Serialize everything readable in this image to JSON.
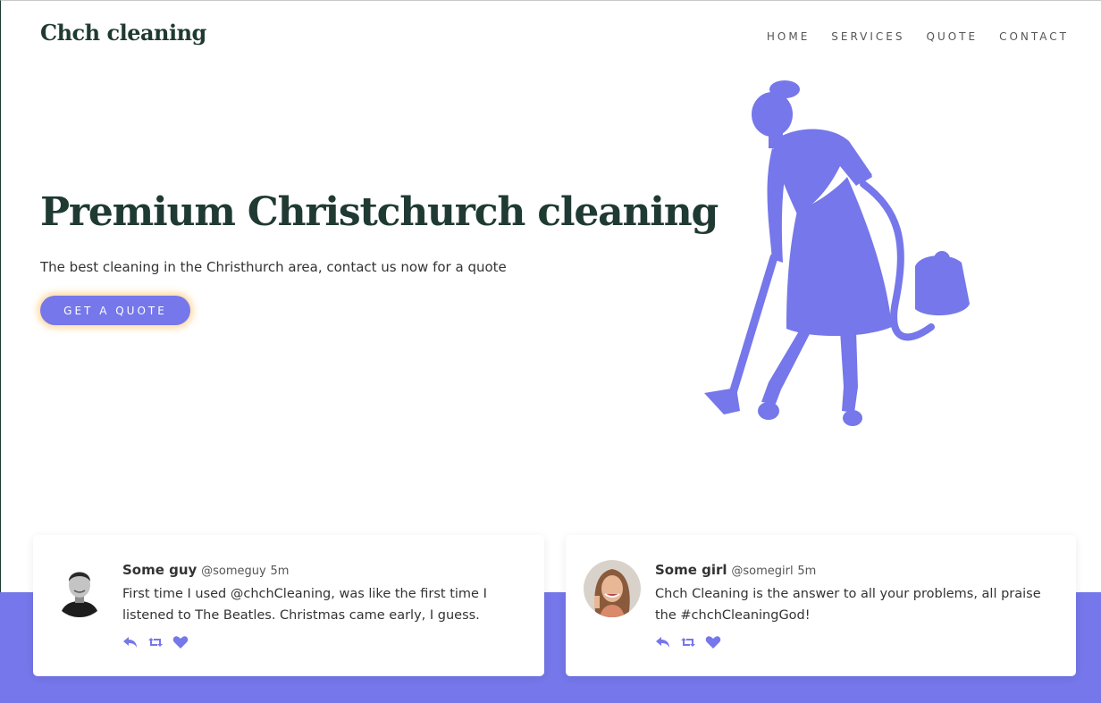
{
  "brand": "Chch cleaning",
  "nav": [
    "HOME",
    "SERVICES",
    "QUOTE",
    "CONTACT"
  ],
  "hero": {
    "title": "Premium Christchurch cleaning",
    "subtitle": "The best cleaning in the Christhurch area, contact us now for a quote",
    "cta": "GET A QUOTE",
    "image": "cleaning-woman-vacuum-silhouette"
  },
  "colors": {
    "accent": "#7577ea",
    "heading": "#1f3a32",
    "cta_glow": "#ffc46e"
  },
  "tweets": [
    {
      "name": "Some guy",
      "handle": "@someguy",
      "time": "5m",
      "text": "First time I used @chchCleaning, was like the first time I listened to The Beatles. Christmas came early, I guess.",
      "avatar": "man-avatar"
    },
    {
      "name": "Some girl",
      "handle": "@somegirl",
      "time": "5m",
      "text": "Chch Cleaning is the answer to all your problems, all praise the #chchCleaningGod!",
      "avatar": "woman-avatar"
    }
  ],
  "tweet_actions": [
    "reply-icon",
    "retweet-icon",
    "heart-icon"
  ]
}
